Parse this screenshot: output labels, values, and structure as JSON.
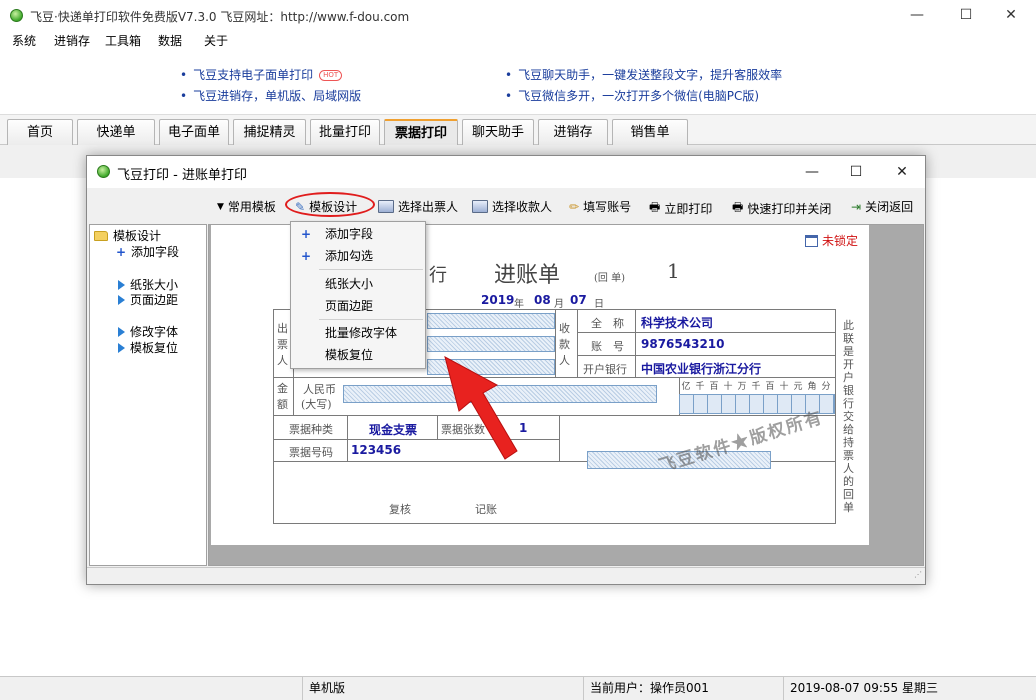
{
  "window": {
    "title": "飞豆·快递单打印软件免费版V7.3.0   飞豆网址：http://www.f-dou.com",
    "minimize": "—",
    "maximize": "☐",
    "close": "✕"
  },
  "menu": [
    "系统",
    "进销存",
    "工具箱",
    "数据",
    "关于"
  ],
  "promo": {
    "left": [
      {
        "text": "飞豆支持电子面单打印",
        "badge": "HOT"
      },
      {
        "text": "飞豆进销存，单机版、局域网版"
      }
    ],
    "right": [
      {
        "text": "飞豆聊天助手，一键发送整段文字，提升客服效率"
      },
      {
        "text": "飞豆微信多开，一次打开多个微信(电脑PC版)"
      }
    ]
  },
  "tabs": [
    {
      "label": "首页",
      "active": false
    },
    {
      "label": "快递单",
      "active": false
    },
    {
      "label": "电子面单",
      "active": false
    },
    {
      "label": "捕捉精灵",
      "active": false
    },
    {
      "label": "批量打印",
      "active": false
    },
    {
      "label": "票据打印",
      "active": true
    },
    {
      "label": "聊天助手",
      "active": false
    },
    {
      "label": "进销存",
      "active": false
    },
    {
      "label": "销售单",
      "active": false
    }
  ],
  "status": {
    "mode": "单机版",
    "user": "当前用户：操作员001",
    "datetime": "2019-08-07 09:55 星期三"
  },
  "dialog": {
    "title": "飞豆打印 - 进账单打印",
    "minimize": "—",
    "maximize": "☐",
    "close": "✕",
    "toolbar": {
      "templates": "常用模板",
      "design": "模板设计",
      "select_payer": "选择出票人",
      "select_payee": "选择收款人",
      "fill_account": "填写账号",
      "print_now": "立即打印",
      "quick_print_close": "快速打印并关闭",
      "close_return": "关闭返回"
    },
    "tree": {
      "root": "模板设计",
      "add_field": "添加字段",
      "paper_size": "纸张大小",
      "page_margin": "页面边距",
      "modify_font": "修改字体",
      "reset_template": "模板复位"
    },
    "dropdown": {
      "add_field": "添加字段",
      "add_check": "添加勾选",
      "paper_size": "纸张大小",
      "page_margin": "页面边距",
      "batch_font": "批量修改字体",
      "reset_template": "模板复位"
    },
    "lock_status": "未锁定",
    "form": {
      "bank_title": "行",
      "doc_title": "进账单",
      "doc_subtitle": "(回 单)",
      "doc_number": "1",
      "date_year": "2019",
      "date_year_unit": "年",
      "date_month": "08",
      "date_month_unit": "月",
      "date_day": "07",
      "date_day_unit": "日",
      "payer_label": "出票人",
      "payee_label": "收款人",
      "full_name_label": "全　称",
      "account_label": "账　号",
      "bank_label": "开户银行",
      "payee_name": "科学技术公司",
      "payee_account": "9876543210",
      "payee_bank": "中国农业银行浙江分行",
      "amount_label": "金额",
      "rmb_label": "人民币",
      "rmb_upper": "(大写)",
      "digits": [
        "亿",
        "千",
        "百",
        "十",
        "万",
        "千",
        "百",
        "十",
        "元",
        "角",
        "分"
      ],
      "bill_type_label": "票据种类",
      "bill_type": "现金支票",
      "bill_count_label": "票据张数",
      "bill_count": "1",
      "bill_no_label": "票据号码",
      "bill_no": "123456",
      "reviewer": "复核",
      "bookkeeper": "记账",
      "side_note": "此联是开户银行交给持票人的回单",
      "watermark": "飞豆软件★版权所有"
    }
  }
}
